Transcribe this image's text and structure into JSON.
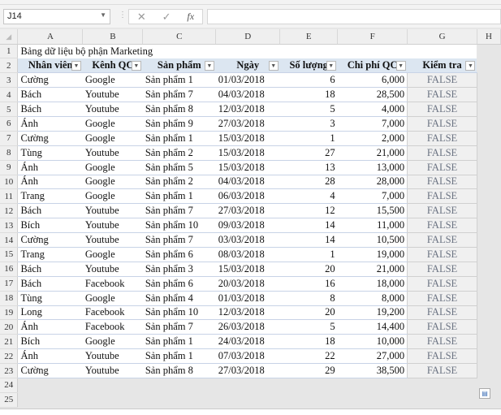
{
  "name_box": "J14",
  "formula_bar": {
    "cancel_icon": "✕",
    "enter_icon": "✓",
    "fx_label": "fx",
    "value": ""
  },
  "columns": [
    "A",
    "B",
    "C",
    "D",
    "E",
    "F",
    "G",
    "H"
  ],
  "title": "Bảng dữ liệu bộ phận Marketing",
  "headers": [
    "Nhân viên",
    "Kênh QC",
    "Sản phẩm",
    "Ngày",
    "Số lượng",
    "Chi phí QC",
    "Kiểm tra"
  ],
  "rows": [
    [
      "Cường",
      "Google",
      "Sản phẩm 1",
      "01/03/2018",
      "6",
      "6,000",
      "FALSE"
    ],
    [
      "Bách",
      "Youtube",
      "Sản phẩm 7",
      "04/03/2018",
      "18",
      "28,500",
      "FALSE"
    ],
    [
      "Bách",
      "Youtube",
      "Sản phẩm 8",
      "12/03/2018",
      "5",
      "4,000",
      "FALSE"
    ],
    [
      "Ánh",
      "Google",
      "Sản phẩm 9",
      "27/03/2018",
      "3",
      "7,000",
      "FALSE"
    ],
    [
      "Cường",
      "Google",
      "Sản phẩm 1",
      "15/03/2018",
      "1",
      "2,000",
      "FALSE"
    ],
    [
      "Tùng",
      "Youtube",
      "Sản phẩm 2",
      "15/03/2018",
      "27",
      "21,000",
      "FALSE"
    ],
    [
      "Ánh",
      "Google",
      "Sản phẩm 5",
      "15/03/2018",
      "13",
      "13,000",
      "FALSE"
    ],
    [
      "Ánh",
      "Google",
      "Sản phẩm 2",
      "04/03/2018",
      "28",
      "28,000",
      "FALSE"
    ],
    [
      "Trang",
      "Google",
      "Sản phẩm 1",
      "06/03/2018",
      "4",
      "7,000",
      "FALSE"
    ],
    [
      "Bách",
      "Youtube",
      "Sản phẩm 7",
      "27/03/2018",
      "12",
      "15,500",
      "FALSE"
    ],
    [
      "Bích",
      "Youtube",
      "Sản phẩm 10",
      "09/03/2018",
      "14",
      "11,000",
      "FALSE"
    ],
    [
      "Cường",
      "Youtube",
      "Sản phẩm 7",
      "03/03/2018",
      "14",
      "10,500",
      "FALSE"
    ],
    [
      "Trang",
      "Google",
      "Sản phẩm 6",
      "08/03/2018",
      "1",
      "19,000",
      "FALSE"
    ],
    [
      "Bách",
      "Youtube",
      "Sản phẩm 3",
      "15/03/2018",
      "20",
      "21,000",
      "FALSE"
    ],
    [
      "Bách",
      "Facebook",
      "Sản phẩm 6",
      "20/03/2018",
      "16",
      "18,000",
      "FALSE"
    ],
    [
      "Tùng",
      "Google",
      "Sản phẩm 4",
      "01/03/2018",
      "8",
      "8,000",
      "FALSE"
    ],
    [
      "Long",
      "Facebook",
      "Sản phẩm 10",
      "12/03/2018",
      "20",
      "19,200",
      "FALSE"
    ],
    [
      "Ánh",
      "Facebook",
      "Sản phẩm 7",
      "26/03/2018",
      "5",
      "14,400",
      "FALSE"
    ],
    [
      "Bích",
      "Google",
      "Sản phẩm 1",
      "24/03/2018",
      "18",
      "10,000",
      "FALSE"
    ],
    [
      "Ánh",
      "Youtube",
      "Sản phẩm 1",
      "07/03/2018",
      "22",
      "27,000",
      "FALSE"
    ],
    [
      "Cường",
      "Youtube",
      "Sản phẩm 8",
      "27/03/2018",
      "29",
      "38,500",
      "FALSE"
    ]
  ],
  "empty_rows": [
    "24",
    "25"
  ]
}
